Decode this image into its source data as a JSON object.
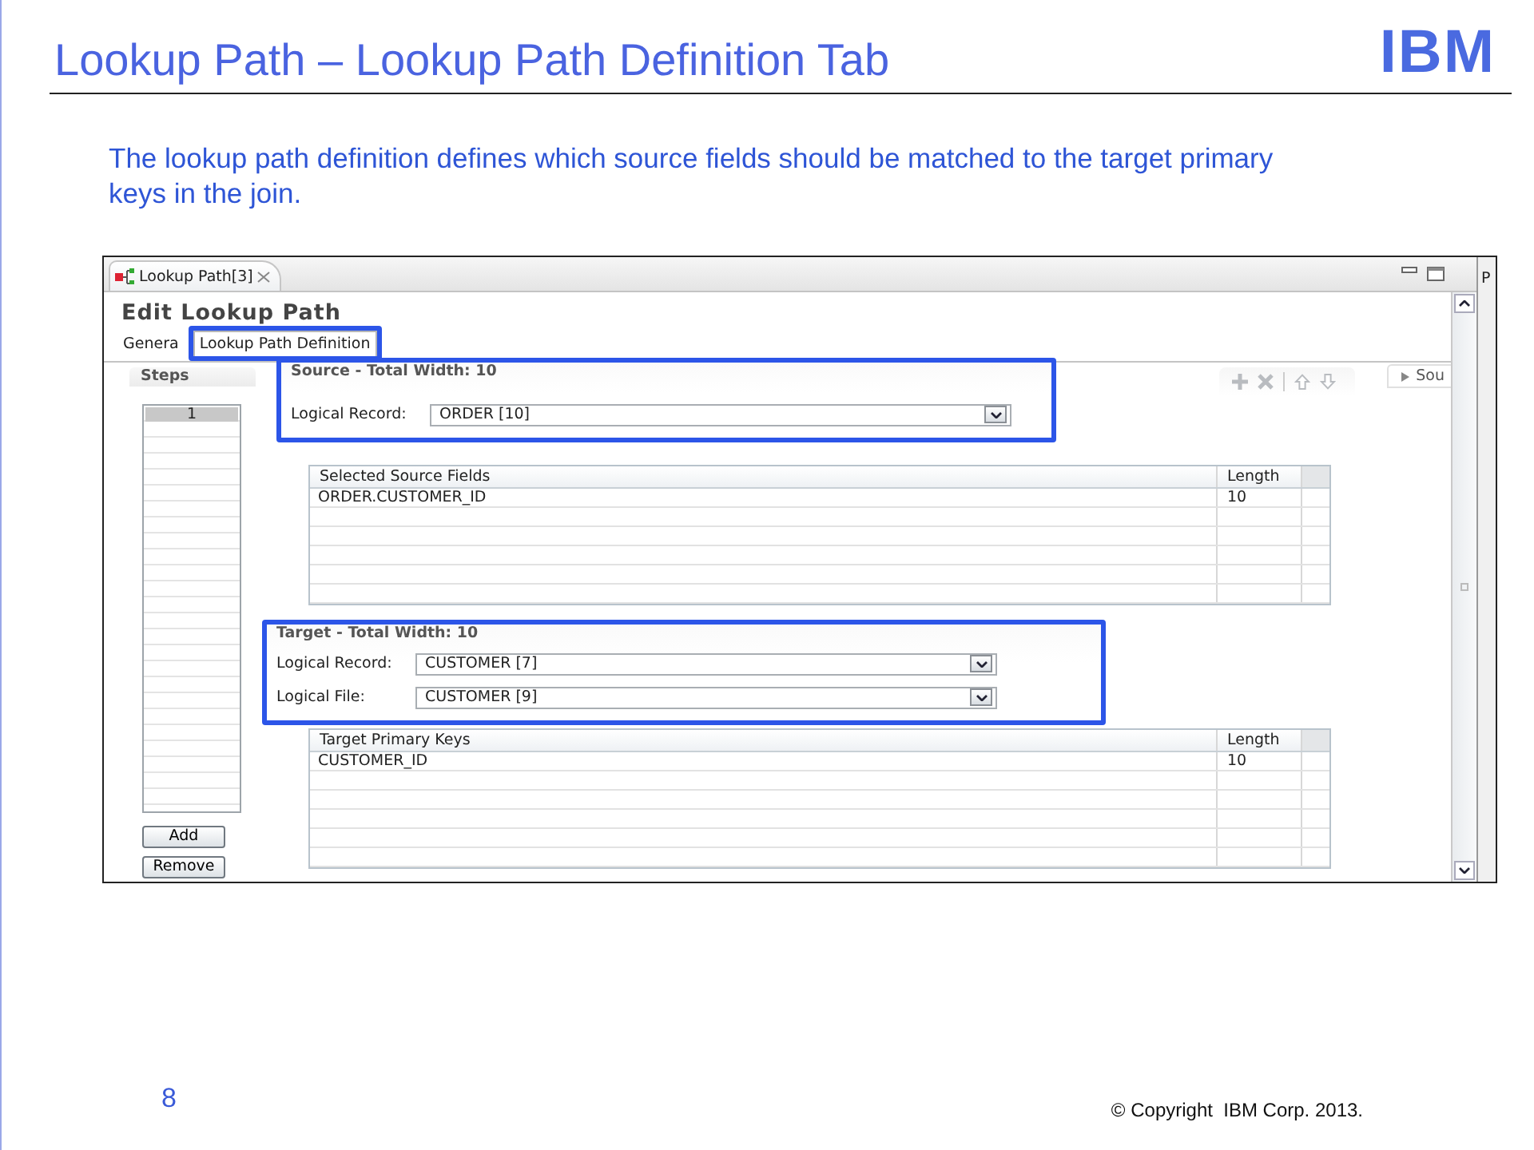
{
  "slide": {
    "title": "Lookup Path – Lookup Path Definition Tab",
    "logo": "IBM",
    "description": "The lookup path definition defines which source fields should be matched to the target primary keys in the join.",
    "page_number": "8",
    "copyright": "© Copyright  IBM Corp. 2013."
  },
  "editor": {
    "tabs": [
      {
        "label": "Lookup Path[3]",
        "selected": true
      }
    ],
    "heading": "Edit Lookup Path",
    "page_tabs": [
      {
        "label": "Genera",
        "selected": false,
        "highlighted": false
      },
      {
        "label": "Lookup Path Definition",
        "selected": true,
        "highlighted": true
      }
    ],
    "steps": {
      "title": "Steps",
      "items": [
        {
          "label": "1",
          "selected": true
        }
      ],
      "buttons": [
        "Add",
        "Remove"
      ]
    },
    "toolbar": [
      {
        "kind": "add",
        "disabled": true
      },
      {
        "kind": "remove",
        "disabled": true
      },
      {
        "kind": "up",
        "disabled": true
      },
      {
        "kind": "down",
        "disabled": true
      }
    ],
    "side_section": {
      "label": "Sou",
      "expanded": false
    },
    "side_strip": {
      "label": "P"
    },
    "source": {
      "title": "Source - Total Width: 10",
      "highlighted": true,
      "fields": [
        {
          "label": "Logical Record:",
          "value": "ORDER [10]"
        }
      ],
      "table": {
        "columns": [
          "Selected Source Fields",
          "Length"
        ],
        "rows": [
          [
            "ORDER.CUSTOMER_ID",
            "10"
          ]
        ]
      }
    },
    "target": {
      "title": "Target - Total Width: 10",
      "highlighted": true,
      "fields": [
        {
          "label": "Logical Record:",
          "value": "CUSTOMER [7]"
        },
        {
          "label": "Logical File:",
          "value": "CUSTOMER [9]"
        }
      ],
      "table": {
        "columns": [
          "Target Primary Keys",
          "Length"
        ],
        "rows": [
          [
            "CUSTOMER_ID",
            "10"
          ]
        ]
      }
    }
  }
}
